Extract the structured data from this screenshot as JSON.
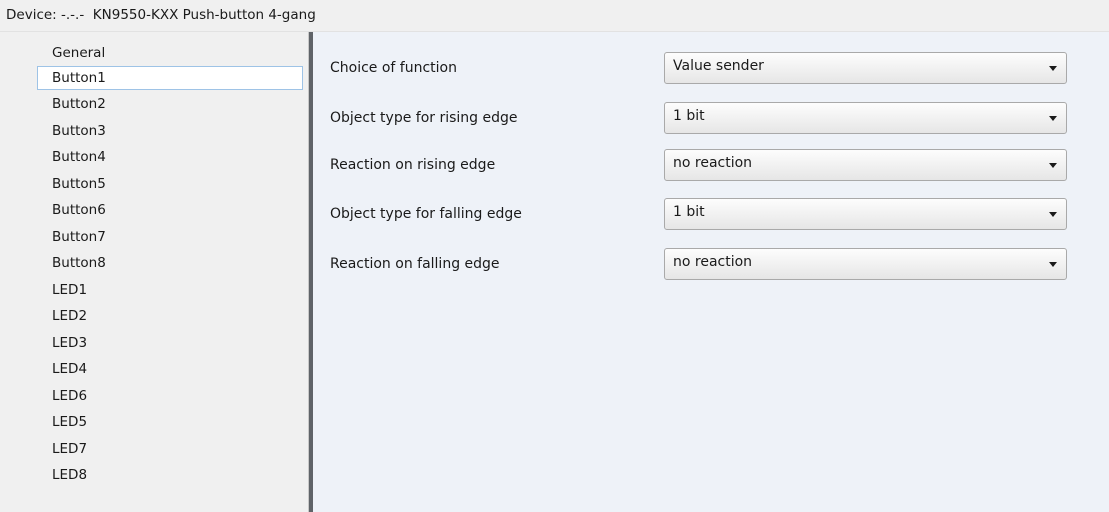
{
  "window": {
    "title": "Device: -.-.-  KN9550-KXX Push-button 4-gang"
  },
  "sidebar": {
    "items": [
      {
        "label": "General",
        "selected": false
      },
      {
        "label": "Button1",
        "selected": true
      },
      {
        "label": "Button2",
        "selected": false
      },
      {
        "label": "Button3",
        "selected": false
      },
      {
        "label": "Button4",
        "selected": false
      },
      {
        "label": "Button5",
        "selected": false
      },
      {
        "label": "Button6",
        "selected": false
      },
      {
        "label": "Button7",
        "selected": false
      },
      {
        "label": "Button8",
        "selected": false
      },
      {
        "label": "LED1",
        "selected": false
      },
      {
        "label": "LED2",
        "selected": false
      },
      {
        "label": "LED3",
        "selected": false
      },
      {
        "label": "LED4",
        "selected": false
      },
      {
        "label": "LED6",
        "selected": false
      },
      {
        "label": "LED5",
        "selected": false
      },
      {
        "label": "LED7",
        "selected": false
      },
      {
        "label": "LED8",
        "selected": false
      }
    ]
  },
  "parameters": [
    {
      "label": "Choice of function",
      "value": "Value sender"
    },
    {
      "label": "Object type for rising edge",
      "value": "1 bit"
    },
    {
      "label": "Reaction on rising edge",
      "value": "no reaction"
    },
    {
      "label": "Object type for falling edge",
      "value": "1 bit"
    },
    {
      "label": "Reaction on falling edge",
      "value": "no reaction"
    }
  ],
  "colors": {
    "panel_background": "#eef2f8",
    "sidebar_background": "#f0f0f0",
    "selection_border": "#9ec3e6",
    "splitter": "#5f6368"
  }
}
